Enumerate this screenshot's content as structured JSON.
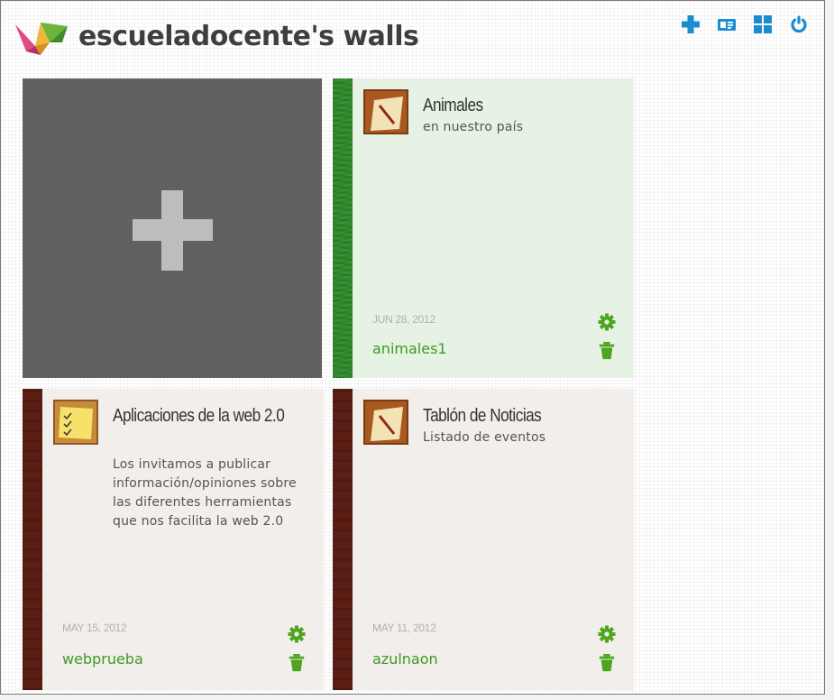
{
  "header": {
    "title": "escueladocente's walls"
  },
  "toolbar": {
    "add_icon": "plus-icon",
    "profile_icon": "id-card-icon",
    "dashboard_icon": "grid-icon",
    "logout_icon": "power-icon",
    "color": "#1a8dd0"
  },
  "colors": {
    "accent": "#4ea51f",
    "new_wall_bg": "#616161"
  },
  "walls": [
    {
      "title": "Animales",
      "description": "en nuestro país",
      "date": "JUN 28, 2012",
      "user": "animales1",
      "strip": "grass",
      "icon": "notepad-icon"
    },
    {
      "title": "Aplicaciones de la web 2.0",
      "description": "Los invitamos a publicar información/opiniones sobre las diferentes herramientas que nos facilita la web 2.0",
      "date": "MAY 15, 2012",
      "user": "webprueba",
      "strip": "wood",
      "icon": "sticky-note-icon"
    },
    {
      "title": "Tablón de Noticias",
      "description": "Listado de eventos",
      "date": "MAY 11, 2012",
      "user": "azulnaon",
      "strip": "wood",
      "icon": "notepad-icon"
    }
  ]
}
